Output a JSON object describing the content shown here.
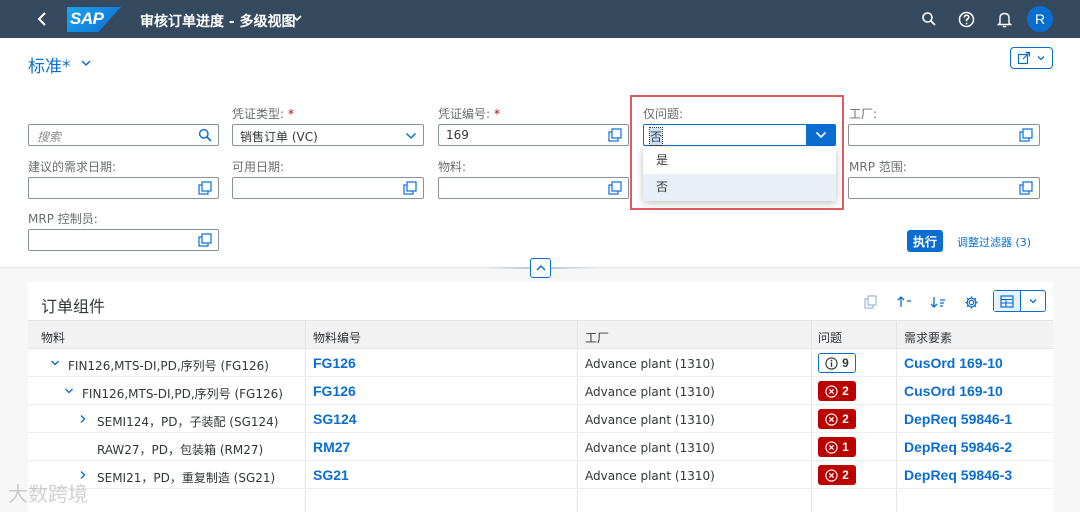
{
  "shell": {
    "logo_text": "SAP",
    "title": "审核订单进度 - 多级视图",
    "avatar_initial": "R",
    "icons": [
      "back-icon",
      "search-icon",
      "help-icon",
      "bell-icon"
    ]
  },
  "header": {
    "variant": "标准*"
  },
  "filters": {
    "search_placeholder": "搜索",
    "doc_type_label": "凭证类型:",
    "doc_type_value": "销售订单 (VC)",
    "doc_number_label": "凭证编号:",
    "doc_number_value": "169",
    "issues_only_label": "仅问题:",
    "issues_only_value": "否",
    "plant_label": "工厂:",
    "req_date_label": "建议的需求日期:",
    "avail_date_label": "可用日期:",
    "material_label": "物料:",
    "mrp_area_label": "MRP 范围:",
    "mrp_controller_label": "MRP 控制员:",
    "execute_label": "执行",
    "adapt_label": "调整过滤器 (3)"
  },
  "dropdown": {
    "options": [
      "是",
      "否"
    ],
    "selected": "否"
  },
  "table": {
    "title": "订单组件",
    "columns": [
      "物料",
      "物料编号",
      "工厂",
      "问题",
      "需求要素"
    ],
    "rows": [
      {
        "material": "FIN126,MTS-DI,PD,序列号 (FG126)",
        "code": "FG126",
        "plant": "Advance plant (1310)",
        "issue_type": "info",
        "issue_count": "9",
        "requirement": "CusOrd 169-10"
      },
      {
        "material": "FIN126,MTS-DI,PD,序列号 (FG126)",
        "code": "FG126",
        "plant": "Advance plant (1310)",
        "issue_type": "error",
        "issue_count": "2",
        "requirement": "CusOrd 169-10"
      },
      {
        "material": "SEMI124，PD，子装配 (SG124)",
        "code": "SG124",
        "plant": "Advance plant (1310)",
        "issue_type": "error",
        "issue_count": "2",
        "requirement": "DepReq 59846-1"
      },
      {
        "material": "RAW27，PD，包装箱 (RM27)",
        "code": "RM27",
        "plant": "Advance plant (1310)",
        "issue_type": "error",
        "issue_count": "1",
        "requirement": "DepReq 59846-2"
      },
      {
        "material": "SEMI21，PD，重复制造 (SG21)",
        "code": "SG21",
        "plant": "Advance plant (1310)",
        "issue_type": "error",
        "issue_count": "2",
        "requirement": "DepReq 59846-3"
      }
    ]
  },
  "watermark": "大数跨境",
  "colors": {
    "shell_bg": "#354a5f",
    "accent": "#0a6ed1",
    "error": "#bb0000",
    "highlight": "#e05a62"
  }
}
